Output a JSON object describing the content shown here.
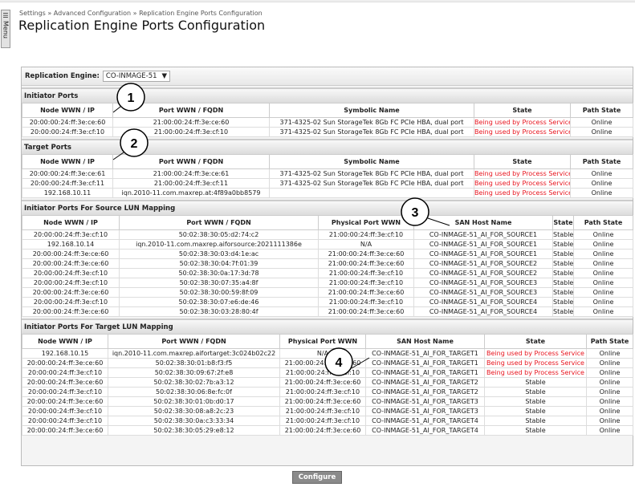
{
  "menu": {
    "label": "Menu",
    "icon": "list-icon"
  },
  "breadcrumb": "Settings » Advanced Configuration » Replication Engine Ports Configuration",
  "title": "Replication Engine Ports Configuration",
  "engine": {
    "label": "Replication Engine:",
    "value": "CO-INMAGE-51"
  },
  "colors": {
    "busy": "#e8141e"
  },
  "sections": [
    {
      "title": "Initiator Ports",
      "cols": [
        113,
        195,
        255,
        120,
        78
      ],
      "headers": [
        "Node WWN / IP",
        "Port WWN / FQDN",
        "Symbolic Name",
        "State",
        "Path State"
      ],
      "rows": [
        [
          "20:00:00:24:ff:3e:ce:60",
          "21:00:00:24:ff:3e:ce:60",
          "371-4325-02 Sun StorageTek 8Gb FC PCIe HBA, dual port",
          "Being used by Process Service",
          "Online"
        ],
        [
          "20:00:00:24:ff:3e:cf:10",
          "21:00:00:24:ff:3e:cf:10",
          "371-4325-02 Sun StorageTek 8Gb FC PCIe HBA, dual port",
          "Being used by Process Service",
          "Online"
        ]
      ]
    },
    {
      "title": "Target Ports",
      "cols": [
        113,
        195,
        255,
        120,
        78
      ],
      "headers": [
        "Node WWN / IP",
        "Port WWN / FQDN",
        "Symbolic Name",
        "State",
        "Path State"
      ],
      "rows": [
        [
          "20:00:00:24:ff:3e:ce:61",
          "21:00:00:24:ff:3e:ce:61",
          "371-4325-02 Sun StorageTek 8Gb FC PCIe HBA, dual port",
          "Being used by Process Service",
          "Online"
        ],
        [
          "20:00:00:24:ff:3e:cf:11",
          "21:00:00:24:ff:3e:cf:11",
          "371-4325-02 Sun StorageTek 8Gb FC PCIe HBA, dual port",
          "Being used by Process Service",
          "Online"
        ],
        [
          "192.168.10.11",
          "iqn.2010-11.com.maxrep.at:4f89a0bb8579",
          "",
          "Being used by Process Service",
          "Online"
        ]
      ]
    },
    {
      "title": "Initiator Ports For Source LUN Mapping",
      "cols": [
        121,
        248,
        119,
        173,
        26,
        74
      ],
      "headers": [
        "Node WWN / IP",
        "Port WWN / FQDN",
        "Physical Port WWN",
        "SAN Host Name",
        "State",
        "Path State"
      ],
      "rows": [
        [
          "20:00:00:24:ff:3e:cf:10",
          "50:02:38:30:05:d2:74:c2",
          "21:00:00:24:ff:3e:cf:10",
          "CO-INMAGE-51_AI_FOR_SOURCE1",
          "Stable",
          "Online"
        ],
        [
          "192.168.10.14",
          "iqn.2010-11.com.maxrep.aiforsource:2021111386e",
          "N/A",
          "CO-INMAGE-51_AI_FOR_SOURCE1",
          "Stable",
          "Online"
        ],
        [
          "20:00:00:24:ff:3e:ce:60",
          "50:02:38:30:03:d4:1e:ac",
          "21:00:00:24:ff:3e:ce:60",
          "CO-INMAGE-51_AI_FOR_SOURCE1",
          "Stable",
          "Online"
        ],
        [
          "20:00:00:24:ff:3e:ce:60",
          "50:02:38:30:04:7f:01:39",
          "21:00:00:24:ff:3e:ce:60",
          "CO-INMAGE-51_AI_FOR_SOURCE2",
          "Stable",
          "Online"
        ],
        [
          "20:00:00:24:ff:3e:cf:10",
          "50:02:38:30:0a:17:3d:78",
          "21:00:00:24:ff:3e:cf:10",
          "CO-INMAGE-51_AI_FOR_SOURCE2",
          "Stable",
          "Online"
        ],
        [
          "20:00:00:24:ff:3e:cf:10",
          "50:02:38:30:07:35:a4:8f",
          "21:00:00:24:ff:3e:cf:10",
          "CO-INMAGE-51_AI_FOR_SOURCE3",
          "Stable",
          "Online"
        ],
        [
          "20:00:00:24:ff:3e:ce:60",
          "50:02:38:30:00:59:8f:09",
          "21:00:00:24:ff:3e:ce:60",
          "CO-INMAGE-51_AI_FOR_SOURCE3",
          "Stable",
          "Online"
        ],
        [
          "20:00:00:24:ff:3e:cf:10",
          "50:02:38:30:07:e6:de:46",
          "21:00:00:24:ff:3e:cf:10",
          "CO-INMAGE-51_AI_FOR_SOURCE4",
          "Stable",
          "Online"
        ],
        [
          "20:00:00:24:ff:3e:ce:60",
          "50:02:38:30:03:28:80:4f",
          "21:00:00:24:ff:3e:ce:60",
          "CO-INMAGE-51_AI_FOR_SOURCE4",
          "Stable",
          "Online"
        ]
      ]
    },
    {
      "title": "Initiator Ports For Target LUN Mapping",
      "cols": [
        107,
        214,
        107,
        148,
        127,
        58
      ],
      "headers": [
        "Node WWN / IP",
        "Port WWN / FQDN",
        "Physical Port WWN",
        "SAN Host Name",
        "State",
        "Path State"
      ],
      "rows": [
        [
          "192.168.10.15",
          "iqn.2010-11.com.maxrep.aifortarget:3c024b02c22",
          "N/A",
          "CO-INMAGE-51_AI_FOR_TARGET1",
          "Being used by Process Service",
          "Online"
        ],
        [
          "20:00:00:24:ff:3e:ce:60",
          "50:02:38:30:01:b8:f3:f5",
          "21:00:00:24:ff:3e:ce:60",
          "CO-INMAGE-51_AI_FOR_TARGET1",
          "Being used by Process Service",
          "Online"
        ],
        [
          "20:00:00:24:ff:3e:cf:10",
          "50:02:38:30:09:67:2f:e8",
          "21:00:00:24:ff:3e:cf:10",
          "CO-INMAGE-51_AI_FOR_TARGET1",
          "Being used by Process Service",
          "Online"
        ],
        [
          "20:00:00:24:ff:3e:ce:60",
          "50:02:38:30:02:7b:a3:12",
          "21:00:00:24:ff:3e:ce:60",
          "CO-INMAGE-51_AI_FOR_TARGET2",
          "Stable",
          "Online"
        ],
        [
          "20:00:00:24:ff:3e:cf:10",
          "50:02:38:30:06:8e:fc:0f",
          "21:00:00:24:ff:3e:cf:10",
          "CO-INMAGE-51_AI_FOR_TARGET2",
          "Stable",
          "Online"
        ],
        [
          "20:00:00:24:ff:3e:ce:60",
          "50:02:38:30:01:0b:d0:17",
          "21:00:00:24:ff:3e:ce:60",
          "CO-INMAGE-51_AI_FOR_TARGET3",
          "Stable",
          "Online"
        ],
        [
          "20:00:00:24:ff:3e:cf:10",
          "50:02:38:30:08:a8:2c:23",
          "21:00:00:24:ff:3e:cf:10",
          "CO-INMAGE-51_AI_FOR_TARGET3",
          "Stable",
          "Online"
        ],
        [
          "20:00:00:24:ff:3e:cf:10",
          "50:02:38:30:0a:c3:33:34",
          "21:00:00:24:ff:3e:cf:10",
          "CO-INMAGE-51_AI_FOR_TARGET4",
          "Stable",
          "Online"
        ],
        [
          "20:00:00:24:ff:3e:ce:60",
          "50:02:38:30:05:29:e8:12",
          "21:00:00:24:ff:3e:ce:60",
          "CO-INMAGE-51_AI_FOR_TARGET4",
          "Stable",
          "Online"
        ]
      ]
    }
  ],
  "callouts": [
    "1",
    "2",
    "3",
    "4"
  ],
  "configure_label": "Configure"
}
